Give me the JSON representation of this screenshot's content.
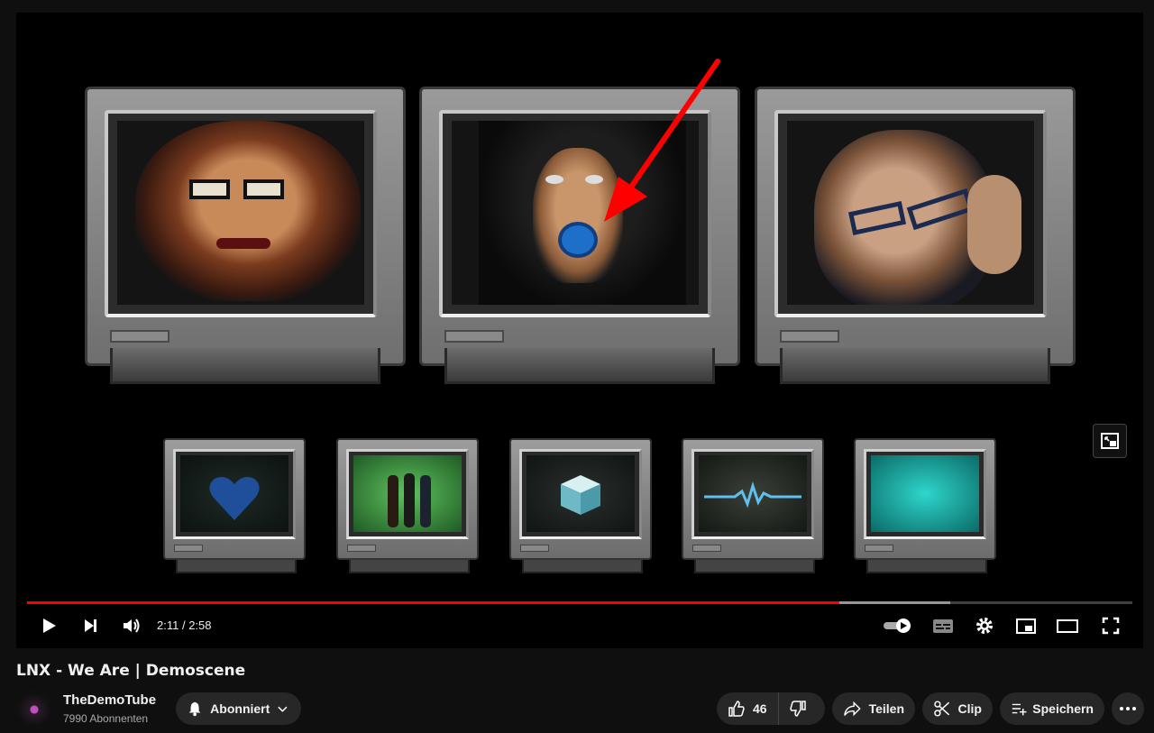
{
  "video": {
    "title": "LNX - We Are | Demoscene",
    "time_current": "2:11",
    "time_sep": " / ",
    "time_total": "2:58",
    "progress_played": 0.735,
    "progress_buffered": 0.835
  },
  "channel": {
    "name": "TheDemoTube",
    "subscribers": "7990 Abonnenten",
    "subscribe_label": "Abonniert"
  },
  "actions": {
    "like_count": "46",
    "share_label": "Teilen",
    "clip_label": "Clip",
    "save_label": "Speichern"
  },
  "colors": {
    "accent": "#ff0000",
    "annotation_arrow": "#ff0000"
  },
  "icons": {
    "play": "play-icon",
    "next": "next-icon",
    "volume": "volume-icon",
    "autoplay": "autoplay-toggle-icon",
    "subtitles": "subtitles-icon",
    "settings": "gear-icon",
    "miniplayer": "miniplayer-icon",
    "theater": "theater-mode-icon",
    "fullscreen": "fullscreen-icon",
    "bell": "bell-icon",
    "like": "thumbs-up-icon",
    "dislike": "thumbs-down-icon",
    "share": "share-icon",
    "clip": "scissors-icon",
    "save": "playlist-add-icon",
    "more": "more-icon"
  }
}
